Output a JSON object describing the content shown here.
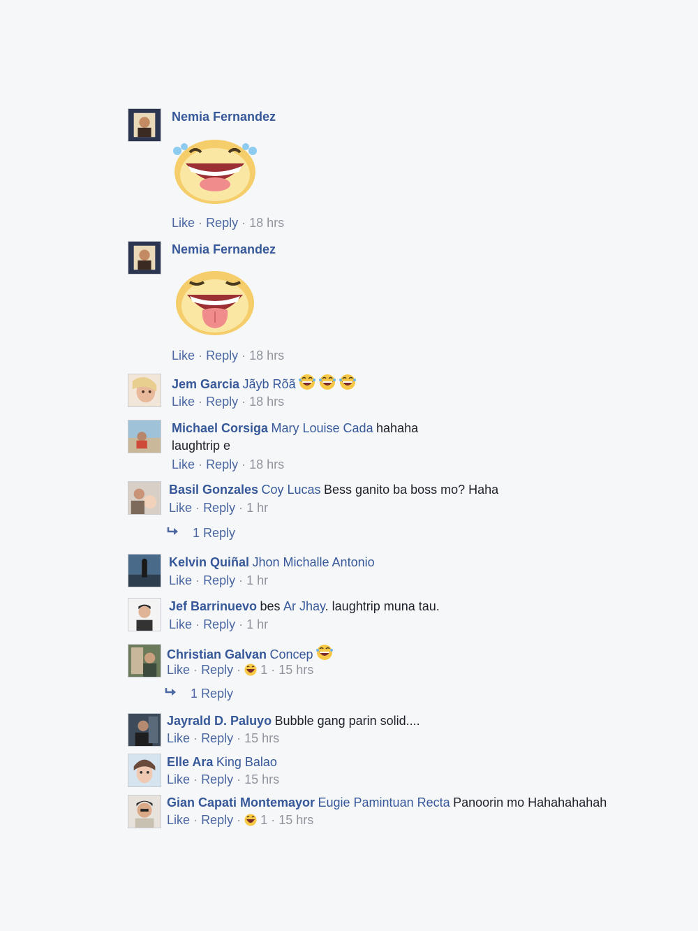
{
  "colors": {
    "background": "#f6f7f9",
    "name_link": "#365899",
    "action_link": "#4b67a1",
    "meta_text": "#90949c",
    "body_text": "#1d2129"
  },
  "labels": {
    "like": "Like",
    "reply": "Reply",
    "sep": "·"
  },
  "comments": [
    {
      "name": "Nemia Fernandez",
      "sticker": "laughing-tears-sticker",
      "time": "18 hrs"
    },
    {
      "name": "Nemia Fernandez",
      "sticker": "tongue-out-sticker",
      "time": "18 hrs"
    },
    {
      "name": "Jem Garcia",
      "tag": "Jãyb Rõã",
      "emoji": "laughing-emoji",
      "time": "18 hrs"
    },
    {
      "name": "Michael Corsiga",
      "tag": "Mary Louise Cada",
      "text1": "hahaha",
      "text2": "laughtrip e",
      "time": "18 hrs"
    },
    {
      "name": "Basil Gonzales",
      "tag": "Coy Lucas",
      "text1": "Bess ganito ba boss mo? Haha",
      "time": "1 hr",
      "replies": "1 Reply"
    },
    {
      "name": "Kelvin Quiñal",
      "tag": "Jhon Michalle Antonio",
      "time": "1 hr"
    },
    {
      "name": "Jef Barrinuevo",
      "text_a": "bes",
      "tag": "Ar Jhay",
      "text1": ". laughtrip muna tau.",
      "time": "1 hr"
    },
    {
      "name": "Christian Galvan",
      "tag": "Concep",
      "emoji": "laughing-emoji",
      "reaction_count": "1",
      "time": "15 hrs",
      "replies": "1 Reply"
    },
    {
      "name": "Jayrald D. Paluyo",
      "text1": "Bubble gang parin solid....",
      "time": "15 hrs"
    },
    {
      "name": "Elle Ara",
      "tag": "King Balao",
      "time": "15 hrs"
    },
    {
      "name": "Gian Capati Montemayor",
      "tag": "Eugie Pamintuan Recta",
      "text1": "Panoorin mo Hahahahahah",
      "reaction_count": "1",
      "time": "15 hrs"
    }
  ]
}
